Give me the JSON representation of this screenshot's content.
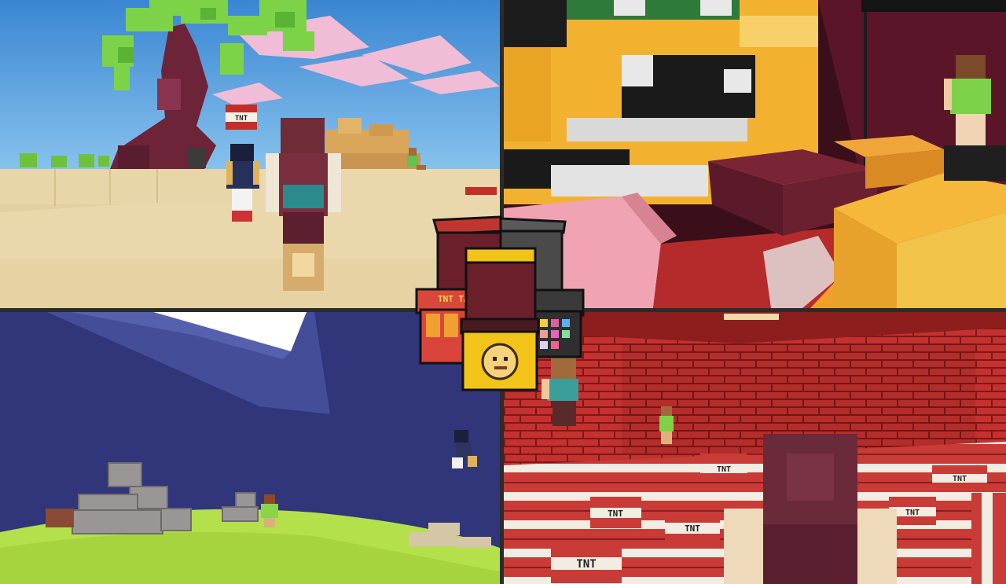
{
  "panels": [
    {
      "id": "beach-scene"
    },
    {
      "id": "arcade-room-scene"
    },
    {
      "id": "hill-night-scene"
    },
    {
      "id": "tnt-room-scene"
    }
  ],
  "tnt_text": "TNT",
  "logo": {
    "sign_text": "TNT TAG"
  },
  "colors": {
    "sky_blue": "#3f8fd6",
    "sand": "#eadcb0",
    "netherrack": "#6a2332",
    "brick_red": "#b8262a",
    "night_sky": "#34397a",
    "grass": "#b6e24a",
    "arcade_yellow": "#f2c419"
  }
}
